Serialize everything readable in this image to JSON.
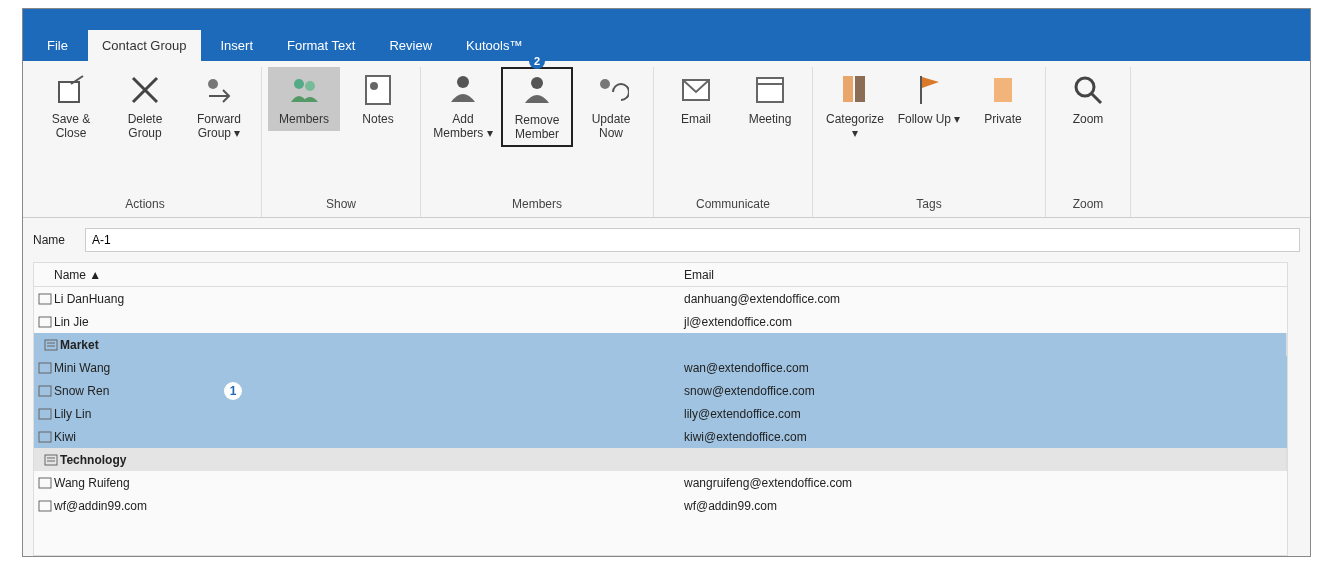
{
  "tabs": [
    {
      "label": "File",
      "selected": false
    },
    {
      "label": "Contact Group",
      "selected": true
    },
    {
      "label": "Insert",
      "selected": false
    },
    {
      "label": "Format Text",
      "selected": false
    },
    {
      "label": "Review",
      "selected": false
    },
    {
      "label": "Kutools™",
      "selected": false
    }
  ],
  "ribbon": [
    {
      "label": "Actions",
      "items": [
        {
          "label": "Save & Close"
        },
        {
          "label": "Delete Group"
        },
        {
          "label": "Forward Group ▾"
        }
      ]
    },
    {
      "label": "Show",
      "items": [
        {
          "label": "Members",
          "selected": true
        },
        {
          "label": "Notes",
          "selected": false
        }
      ]
    },
    {
      "label": "Members",
      "items": [
        {
          "label": "Add Members ▾"
        },
        {
          "label": "Remove Member",
          "callout": "2"
        },
        {
          "label": "Update Now"
        }
      ]
    },
    {
      "label": "Communicate",
      "items": [
        {
          "label": "Email"
        },
        {
          "label": "Meeting"
        }
      ]
    },
    {
      "label": "Tags",
      "items": [
        {
          "label": "Categorize ▾"
        },
        {
          "label": "Follow Up ▾"
        },
        {
          "label": "Private"
        }
      ]
    },
    {
      "label": "Zoom",
      "items": [
        {
          "label": "Zoom"
        }
      ]
    }
  ],
  "name_field": {
    "label": "Name",
    "value": "A-1"
  },
  "list": {
    "columns": [
      "Name ▲",
      "Email"
    ],
    "rows": [
      {
        "kind": "contact",
        "name": "Li DanHuang",
        "email": "danhuang@extendoffice.com",
        "selected": false
      },
      {
        "kind": "contact",
        "name": "Lin Jie",
        "email": "jl@extendoffice.com",
        "selected": false
      },
      {
        "kind": "group",
        "name": "Market",
        "selected": true
      },
      {
        "kind": "contact",
        "name": "Mini Wang",
        "email": "wan@extendoffice.com",
        "selected": true
      },
      {
        "kind": "contact",
        "name": "Snow Ren",
        "email": "snow@extendoffice.com",
        "selected": true,
        "callout": "1"
      },
      {
        "kind": "contact",
        "name": "Lily Lin",
        "email": "lily@extendoffice.com",
        "selected": true
      },
      {
        "kind": "contact",
        "name": "Kiwi",
        "email": "kiwi@extendoffice.com",
        "selected": true
      },
      {
        "kind": "group",
        "name": "Technology",
        "selected": false
      },
      {
        "kind": "contact",
        "name": "Wang Ruifeng",
        "email": "wangruifeng@extendoffice.com",
        "selected": false
      },
      {
        "kind": "contact",
        "name": "wf@addin99.com",
        "email": "wf@addin99.com",
        "selected": false
      }
    ]
  }
}
